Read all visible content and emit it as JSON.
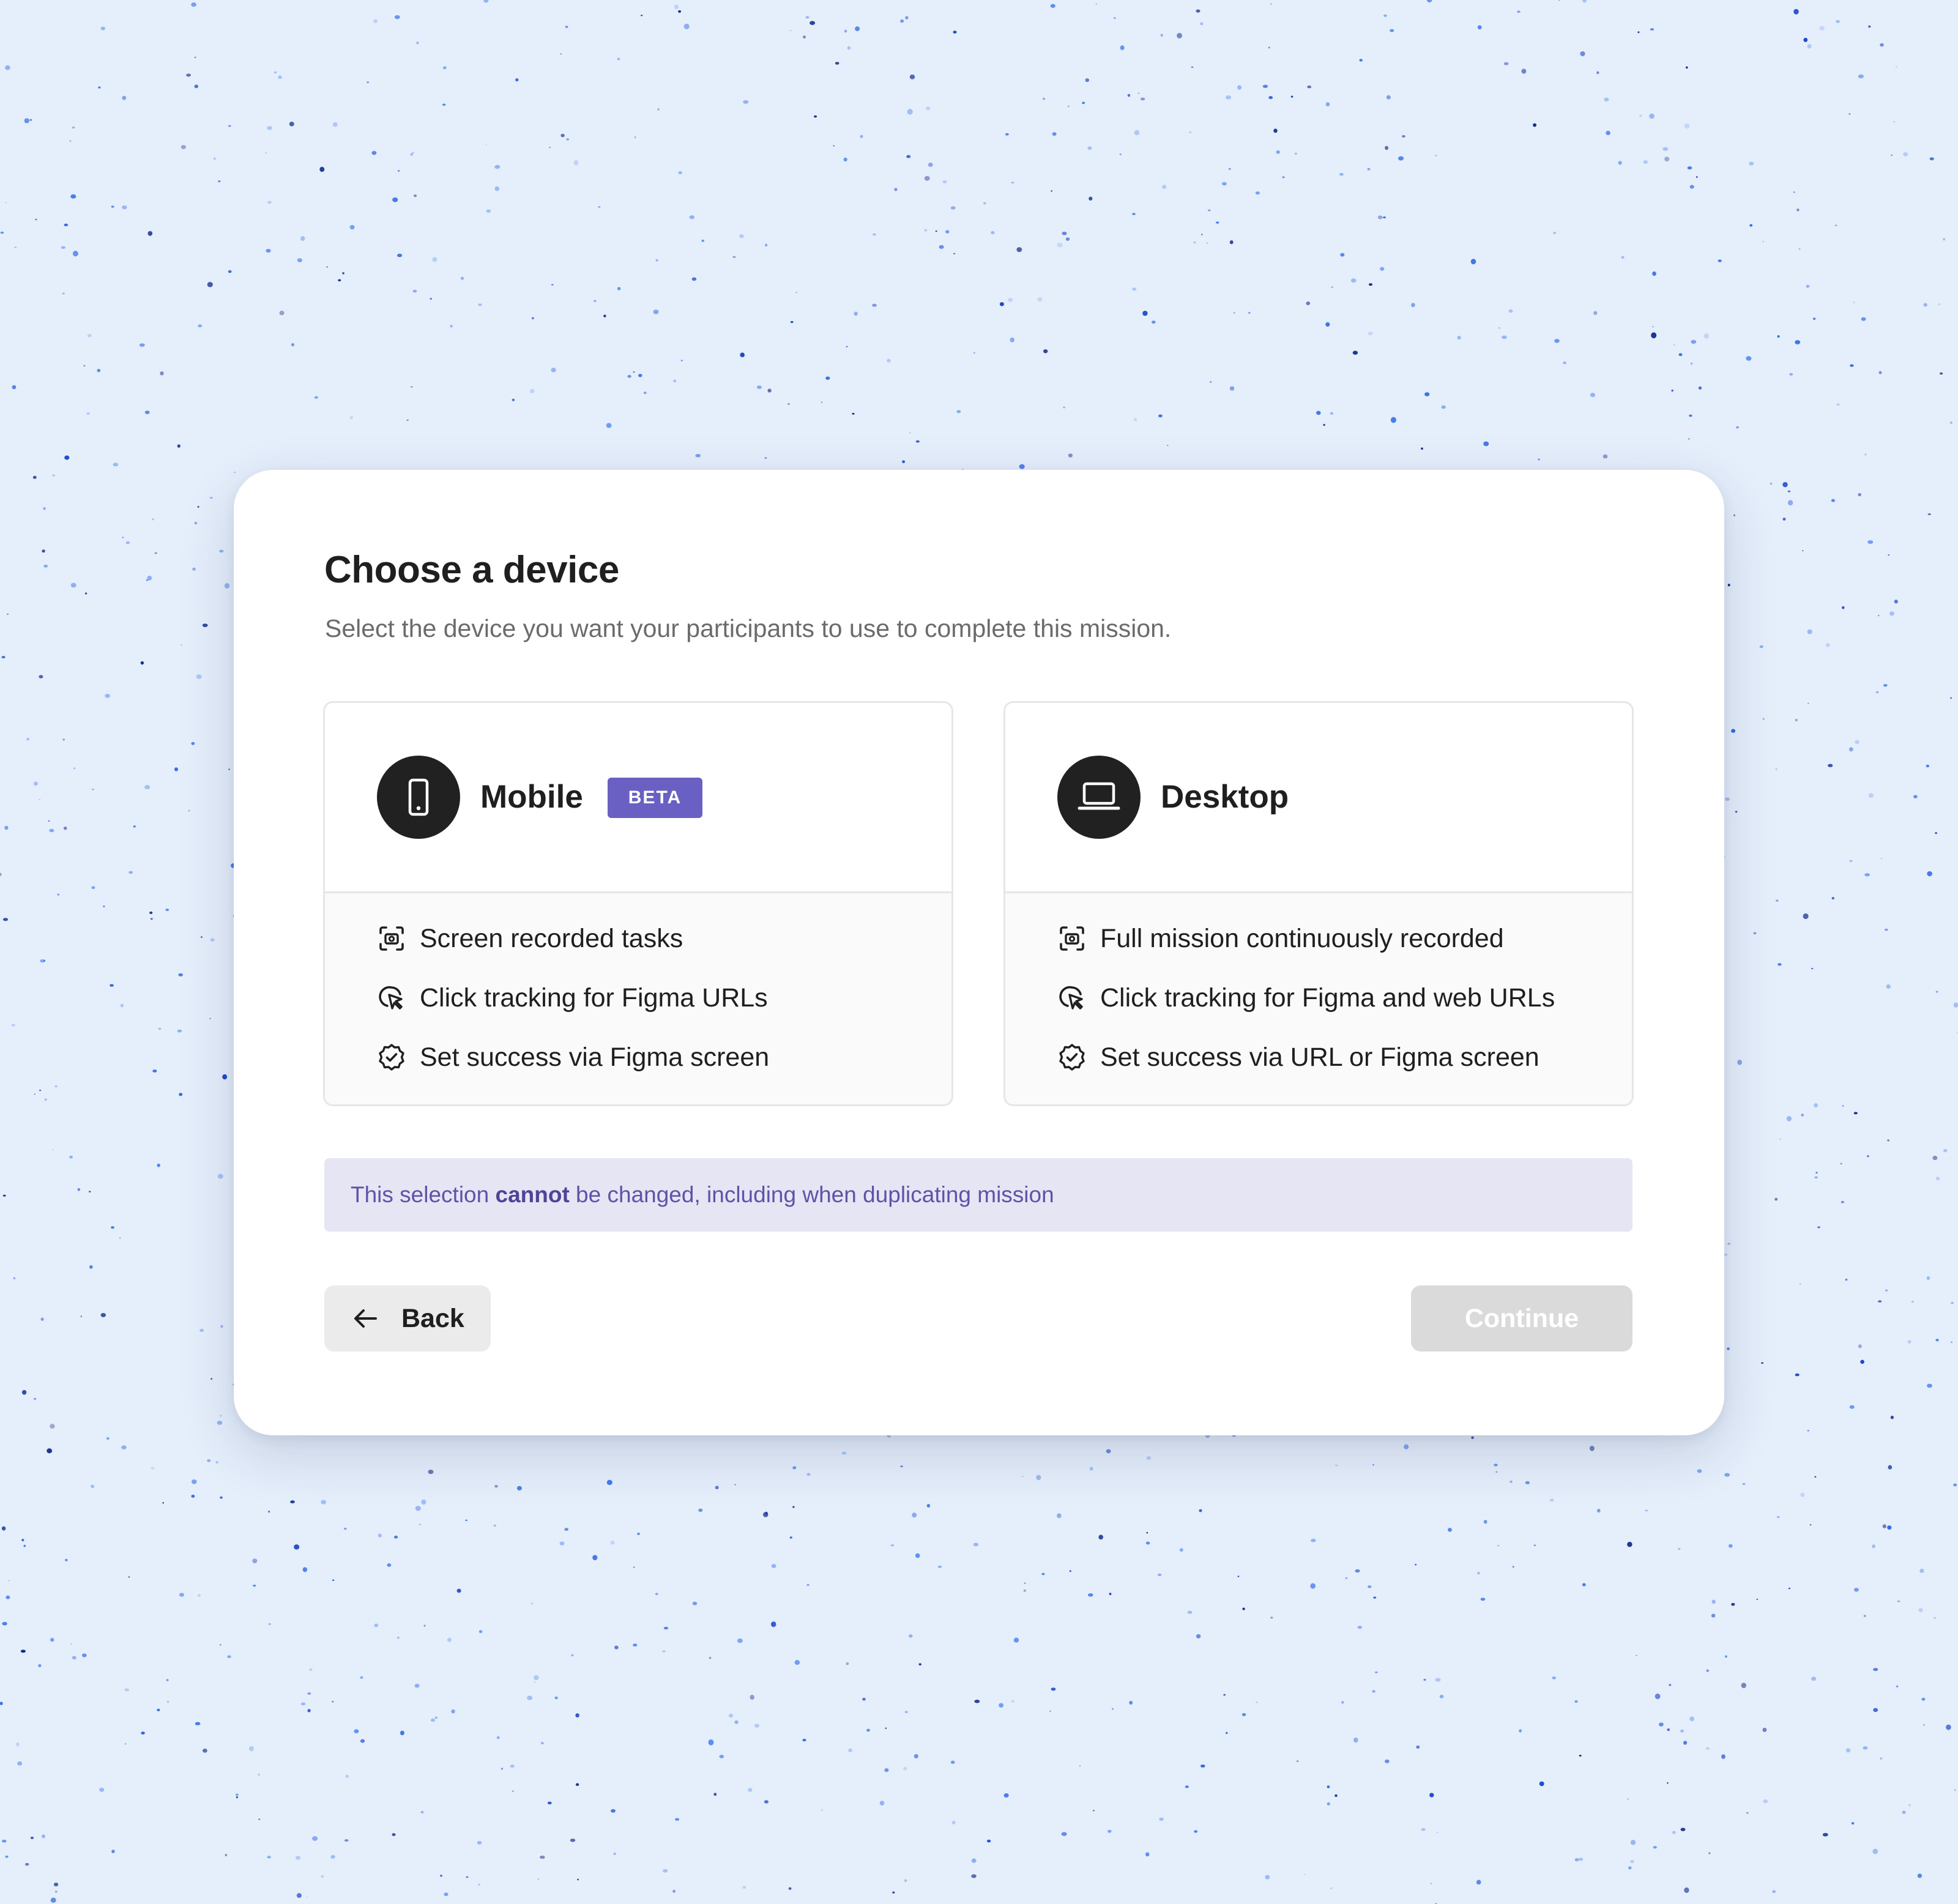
{
  "dialog": {
    "title": "Choose a device",
    "subtitle": "Select the device you want your participants to use to complete this mission."
  },
  "options": [
    {
      "name": "Mobile",
      "badge": "BETA",
      "icon": "smartphone-icon",
      "features": [
        {
          "icon": "screen-record-icon",
          "label": "Screen recorded tasks"
        },
        {
          "icon": "cursor-click-icon",
          "label": "Click tracking for Figma URLs"
        },
        {
          "icon": "badge-check-icon",
          "label": "Set success via Figma screen"
        }
      ]
    },
    {
      "name": "Desktop",
      "icon": "laptop-icon",
      "features": [
        {
          "icon": "screen-record-icon",
          "label": "Full mission continuously recorded"
        },
        {
          "icon": "cursor-click-icon",
          "label": "Click tracking for Figma and web URLs"
        },
        {
          "icon": "badge-check-icon",
          "label": "Set success via URL or Figma screen"
        }
      ]
    }
  ],
  "notice": {
    "before": "This selection ",
    "emphasis": "cannot",
    "after": " be changed, including when duplicating mission"
  },
  "actions": {
    "back_label": "Back",
    "continue_label": "Continue",
    "continue_disabled": true
  },
  "colors": {
    "page_background": "#e5eefb",
    "beta_badge": "#6a60c4",
    "notice_background": "#e6e5f4",
    "notice_text": "#5d53a8",
    "device_circle": "#212121",
    "continue_disabled": "#dadada"
  }
}
